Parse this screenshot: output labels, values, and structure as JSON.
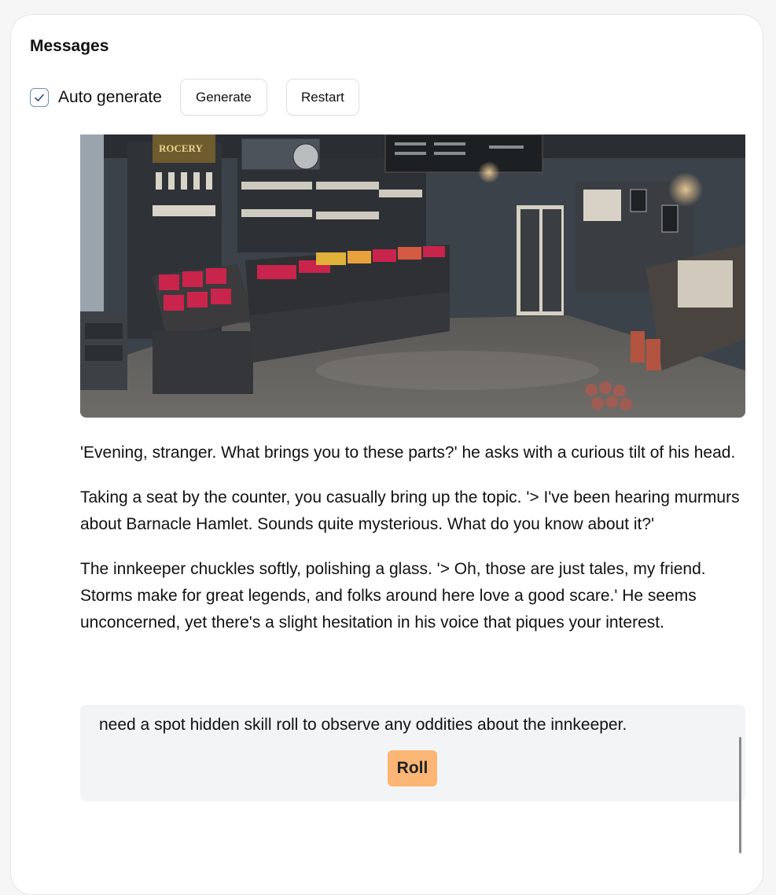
{
  "panel": {
    "title": "Messages"
  },
  "controls": {
    "auto_generate": {
      "label": "Auto generate",
      "checked": true
    },
    "generate_label": "Generate",
    "restart_label": "Restart"
  },
  "scene_image": {
    "icon": "general-store-interior-illustration",
    "sign_text": "ROCERY"
  },
  "messages": [
    "'Evening, stranger. What brings you to these parts?' he asks with a curious tilt of his head.",
    "Taking a seat by the counter, you casually bring up the topic. '> I've been hearing murmurs about Barnacle Hamlet. Sounds quite mysterious. What do you know about it?'",
    "The innkeeper chuckles softly, polishing a glass. '> Oh, those are just tales, my friend. Storms make for great legends, and folks around here love a good scare.' He seems unconcerned, yet there's a slight hesitation in his voice that piques your interest."
  ],
  "roll_prompt": {
    "text": "need a spot hidden skill roll to observe any oddities about the innkeeper.",
    "button_label": "Roll",
    "button_color": "#fbb574"
  }
}
